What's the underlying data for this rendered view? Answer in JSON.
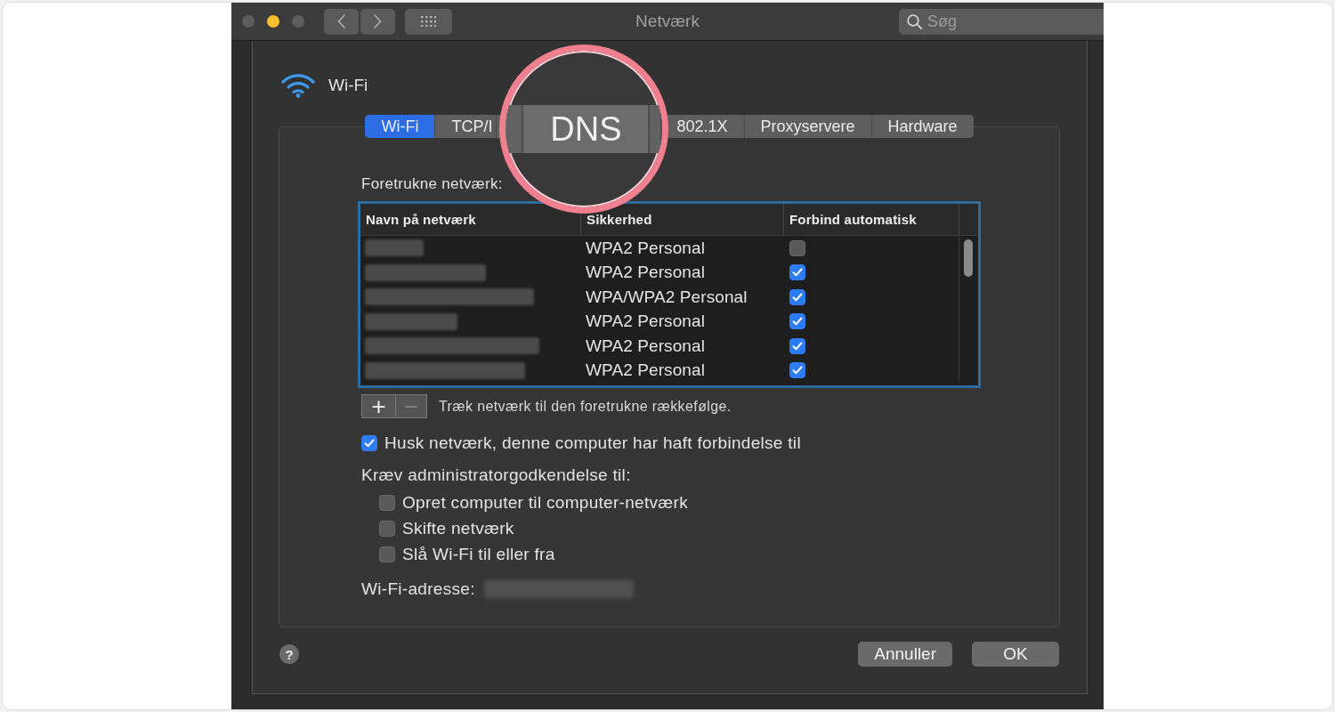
{
  "window": {
    "title": "Netværk",
    "search": {
      "placeholder": "Søg"
    }
  },
  "interface": {
    "name": "Wi-Fi"
  },
  "tabs": [
    {
      "kind": "tab",
      "label": "Wi-Fi",
      "selected": true
    },
    {
      "kind": "tab",
      "label": "TCP/I",
      "selected": false
    },
    {
      "kind": "magnified",
      "label": "DNS",
      "selected": false
    },
    {
      "kind": "tab",
      "label": "802.1X",
      "selected": false
    },
    {
      "kind": "tab",
      "label": "Proxyservere",
      "selected": false
    },
    {
      "kind": "tab",
      "label": "Hardware",
      "selected": false
    }
  ],
  "preferred_networks": {
    "label": "Foretrukne netværk:",
    "focused": true,
    "columns": [
      "Navn på netværk",
      "Sikkerhed",
      "Forbind automatisk"
    ],
    "rows": [
      {
        "security": "WPA2 Personal",
        "auto_join": false
      },
      {
        "security": "WPA2 Personal",
        "auto_join": true
      },
      {
        "security": "WPA/WPA2 Personal",
        "auto_join": true
      },
      {
        "security": "WPA2 Personal",
        "auto_join": true
      },
      {
        "security": "WPA2 Personal",
        "auto_join": true
      },
      {
        "security": "WPA2 Personal",
        "auto_join": true
      }
    ]
  },
  "list_buttons": [
    {
      "label": "+",
      "disabled": false
    },
    {
      "label": "−",
      "disabled": true
    }
  ],
  "hint": "Træk netværk til den foretrukne rækkefølge.",
  "remember": {
    "label": "Husk netværk, denne computer har haft forbindelse til",
    "checked": true
  },
  "admin": {
    "heading": "Kræv administratorgodkendelse til:",
    "options": [
      {
        "label": "Opret computer til computer-netværk",
        "checked": false
      },
      {
        "label": "Skifte netværk",
        "checked": false
      },
      {
        "label": "Slå Wi-Fi til eller fra",
        "checked": false
      }
    ]
  },
  "wifi_address": {
    "label": "Wi-Fi-adresse:"
  },
  "help_button": {
    "label": "?"
  },
  "buttons": [
    "Annuller",
    "OK"
  ]
}
